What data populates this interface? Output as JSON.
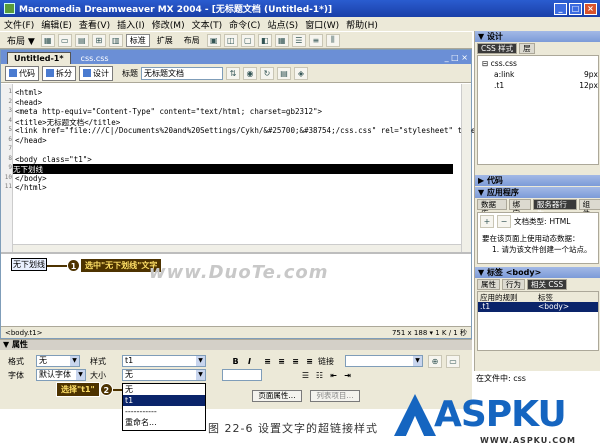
{
  "window": {
    "title": "Macromedia Dreamweaver MX 2004 - [无标题文档 (Untitled-1*)]"
  },
  "menu": [
    "文件(F)",
    "编辑(E)",
    "查看(V)",
    "插入(I)",
    "修改(M)",
    "文本(T)",
    "命令(C)",
    "站点(S)",
    "窗口(W)",
    "帮助(H)"
  ],
  "insert_toolbar": {
    "category": "布局 ▼",
    "tabs": [
      "标准",
      "扩展",
      "布局"
    ]
  },
  "document": {
    "tabs": [
      "Untitled-1*",
      "css.css"
    ],
    "views": {
      "code": "代码",
      "split": "拆分",
      "design": "设计"
    },
    "title_label": "标题",
    "title_value": "无标题文档",
    "code_lines": [
      "<html>",
      "<head>",
      "<meta http-equiv=\"Content-Type\" content=\"text/html; charset=gb2312\">",
      "<title>无标题文档</title>",
      "<link href=\"file:///C|/Documents%20and%20Settings/Cykh/&#25700;&#38754;/css.css\" rel=\"stylesheet\" type",
      "</head>",
      "",
      "<body class=\"t1\">",
      "无下划线",
      "</body>",
      "</html>"
    ],
    "highlight_line": 8,
    "design_text": "无下划线",
    "callout1": {
      "num": "1",
      "text": "选中\"无下划线\"文字"
    },
    "watermark": "www.DuoTe.com",
    "status_tag": "<body.t1>",
    "status_right": "751 x 188 ▾ 1 K / 1 秒"
  },
  "right_panels": {
    "design_head": "▼ 设计",
    "css_tabs": [
      "CSS 样式",
      "层"
    ],
    "css_rows": [
      {
        "name": "⊟ css.css",
        "value": ""
      },
      {
        "name": "a:link",
        "value": "9px"
      },
      {
        "name": ".t1",
        "value": "12px"
      }
    ],
    "code_head": "▶ 代码",
    "app_head": "▼ 应用程序",
    "app_tabs": [
      "数据库",
      "绑定",
      "服务器行为",
      "组件"
    ],
    "doc_type_label": "文档类型:",
    "doc_type_value": "HTML",
    "app_message": "要在该页面上使用动态数据：",
    "app_step": "1. 请为该文件创建一个站点。",
    "tag_head": "▼ 标签 <body>",
    "tag_tabs": [
      "属性",
      "行为",
      "相关 CSS"
    ],
    "tag_cols": [
      "应用的规则",
      "标签"
    ],
    "tag_row": [
      ".t1",
      "<body>"
    ],
    "files_label": "在文件中: css"
  },
  "properties": {
    "head": "▼ 属性",
    "format_label": "格式",
    "format_value": "无",
    "style_label": "样式",
    "style_value": "t1",
    "font_label": "字体",
    "font_value": "默认字体",
    "size_label": "大小",
    "size_value": "无",
    "link_label": "链接",
    "page_props_btn": "页面属性...",
    "list_item_btn": "列表项目...",
    "callout2": {
      "num": "2",
      "text": "选择\"t1\""
    },
    "dropdown_options": [
      "无",
      "t1",
      "-----------",
      "重命名..."
    ]
  },
  "caption": "图 22-6   设置文字的超链接样式",
  "logo": {
    "word": "ASPKU",
    "url": "WWW.ASPKU.COM"
  }
}
